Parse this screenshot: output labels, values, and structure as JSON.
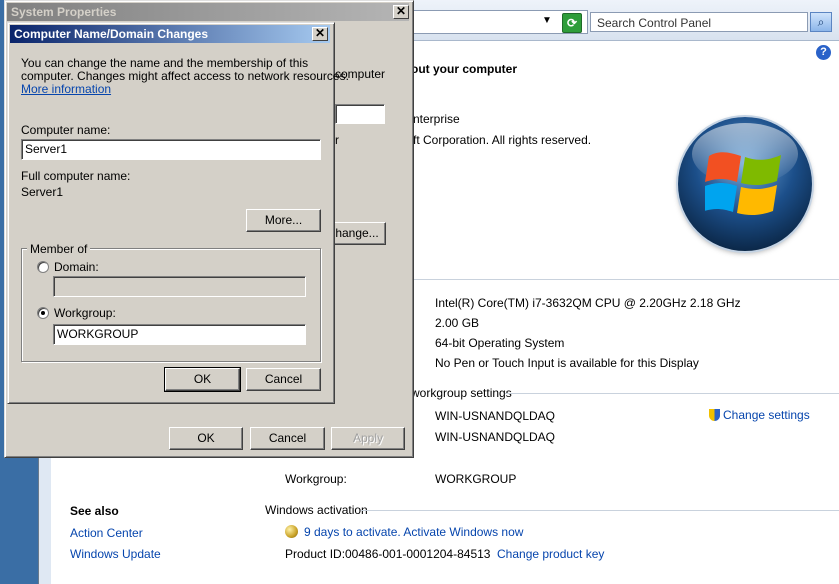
{
  "control_panel": {
    "search_placeholder": "Search Control Panel",
    "header_fragment": "out your computer",
    "edition_fragment": "nterprise",
    "copyright_fragment": "ft Corporation.  All rights reserved.",
    "system": {
      "processor": "Intel(R) Core(TM) i7-3632QM CPU @ 2.20GHz   2.18 GHz",
      "memory": "2.00 GB",
      "system_type": "64-bit Operating System",
      "pen_touch": "No Pen or Touch Input is available for this Display"
    },
    "name_section_fragment": "workgroup settings",
    "computer_name": "WIN-USNANDQLDAQ",
    "full_computer_name": "WIN-USNANDQLDAQ",
    "change_settings_link": "Change settings",
    "workgroup_label": "Workgroup:",
    "workgroup_value": "WORKGROUP",
    "see_also": {
      "heading": "See also",
      "links": [
        "Action Center",
        "Windows Update"
      ]
    },
    "activation": {
      "heading": "Windows activation",
      "days_text": "9 days to activate. Activate Windows now",
      "product_id_label": "Product ID:",
      "product_id": "00486-001-0001204-84513",
      "change_key_link": "Change product key"
    }
  },
  "system_properties": {
    "title": "System Properties",
    "close_glyph": "✕",
    "behind_text_1": "computer",
    "behind_text_2": "r",
    "behind_change_button": "hange...",
    "ok_label": "OK",
    "cancel_label": "Cancel",
    "apply_label": "Apply"
  },
  "name_changes_dialog": {
    "title": "Computer Name/Domain Changes",
    "close_glyph": "✕",
    "description_line1": "You can change the name and the membership of this",
    "description_line2": "computer. Changes might affect access to network resources.",
    "more_info_link": "More information",
    "computer_name_label": "Computer name:",
    "computer_name_value": "Server1",
    "full_name_label": "Full computer name:",
    "full_name_value": "Server1",
    "more_button": "More...",
    "member_of_label": "Member of",
    "domain_label": "Domain:",
    "domain_value": "",
    "workgroup_label": "Workgroup:",
    "workgroup_value": "WORKGROUP",
    "selected_membership": "Workgroup",
    "ok_label": "OK",
    "cancel_label": "Cancel"
  }
}
